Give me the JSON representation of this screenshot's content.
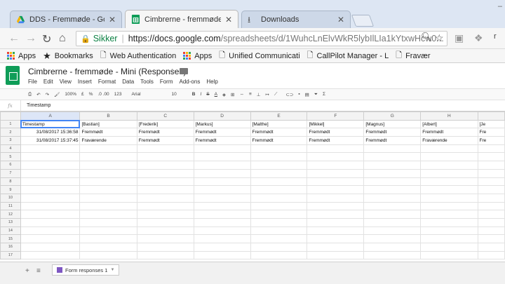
{
  "browser": {
    "tabs": [
      {
        "title": "DDS - Fremmøde - Goog",
        "icon": "google-drive-icon",
        "active": false
      },
      {
        "title": "Cimbrerne - fremmøde -",
        "icon": "google-sheets-icon",
        "active": true
      },
      {
        "title": "Downloads",
        "icon": "download-icon",
        "active": false
      }
    ],
    "address": {
      "secure_label": "Sikker",
      "url_host": "https://docs.google.com",
      "url_path": "/spreadsheets/d/1WuhcLnElvWkR5lybIlLIa1kYtxwHcw0..."
    },
    "bookmarks": [
      {
        "label": "Apps",
        "icon": "apps-grid-icon"
      },
      {
        "label": "Bookmarks",
        "icon": "star-icon"
      },
      {
        "label": "Web Authentication",
        "icon": "page-icon"
      },
      {
        "label": "Apps",
        "icon": "apps-grid-icon"
      },
      {
        "label": "Unified Communicati",
        "icon": "page-icon"
      },
      {
        "label": "CallPilot Manager - L",
        "icon": "page-icon"
      },
      {
        "label": "Fravær",
        "icon": "page-icon"
      }
    ],
    "colors": {
      "accent_green": "#0f9d58",
      "secure_green": "#0b8043",
      "selection_blue": "#4285f4"
    }
  },
  "sheets": {
    "doc_title": "Cimbrerne - fremmøde - Mini (Responses)",
    "menu": [
      "File",
      "Edit",
      "View",
      "Insert",
      "Format",
      "Data",
      "Tools",
      "Form",
      "Add-ons",
      "Help"
    ],
    "toolbar": {
      "zoom": "100%",
      "currency": "£",
      "percent": "%",
      "decimals": ".0 .00",
      "number_format": "123",
      "font": "Arial",
      "font_size": "10"
    },
    "formula_bar": {
      "fx": "fx",
      "value": "Timestamp"
    },
    "columns": [
      "A",
      "B",
      "C",
      "D",
      "E",
      "F",
      "G",
      "H"
    ],
    "rows": [
      [
        "Timestamp",
        "[Bastian]",
        "[Frederik]",
        "[Markus]",
        "[Malthe]",
        "[Mikkel]",
        "[Magnus]",
        "[Albert]",
        "[Je"
      ],
      [
        "31/08/2017 15:36:58",
        "Fremmødt",
        "Fremmødt",
        "Fremmødt",
        "Fremmødt",
        "Fremmødt",
        "Fremmødt",
        "Fremmødt",
        "Fre"
      ],
      [
        "31/08/2017 15:37:45",
        "Fraværende",
        "Fremmødt",
        "Fremmødt",
        "Fremmødt",
        "Fremmødt",
        "Fremmødt",
        "Fraværende",
        "Fre"
      ]
    ],
    "row_numbers": [
      "1",
      "2",
      "3",
      "4",
      "5",
      "6",
      "7",
      "8",
      "9",
      "10",
      "11",
      "12",
      "13",
      "14",
      "15",
      "16",
      "17"
    ],
    "sheet_tab": "Form responses 1"
  }
}
